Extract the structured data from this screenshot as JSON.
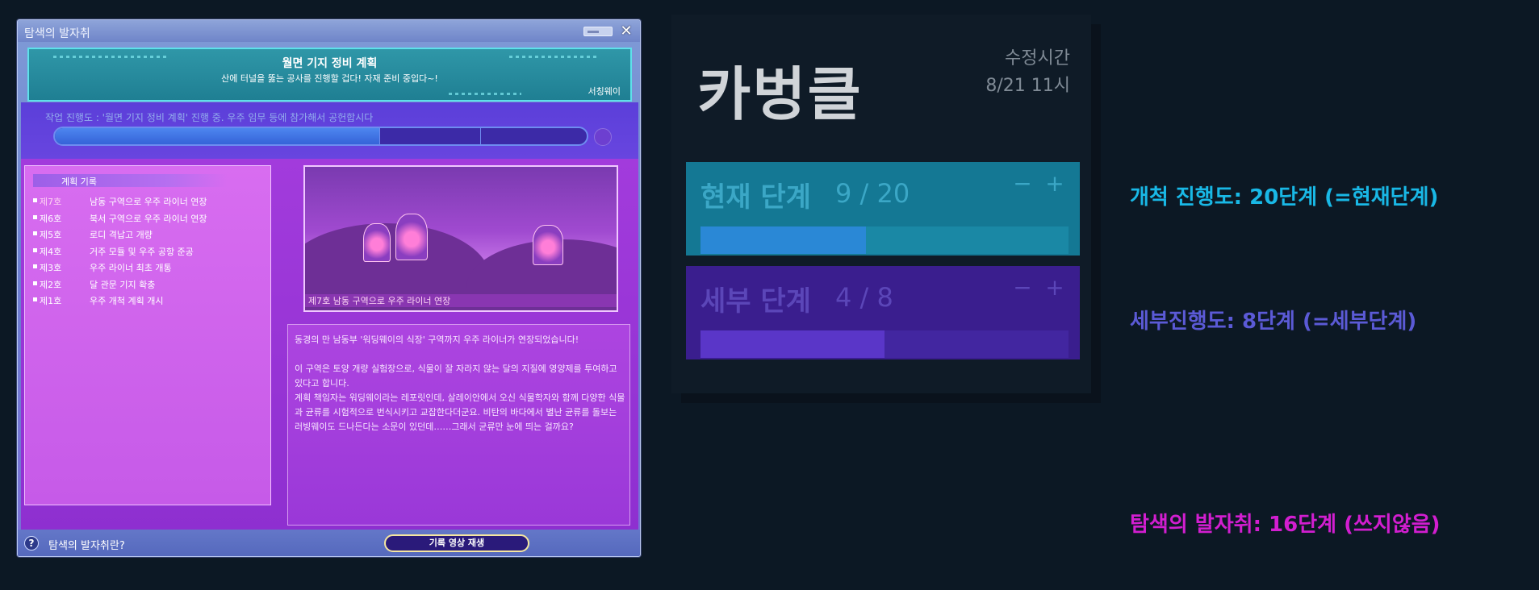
{
  "game_window": {
    "title": "탐색의 발자취",
    "banner": {
      "title": "월면 기지 정비 계획",
      "subtitle": "산에 터널을 뚫는 공사를 진행할 겁다! 자재 준비 중입다~!",
      "signature": "서칭웨이"
    },
    "progress": {
      "label": "작업 진행도 : '월면 기지 정비 계획' 진행 중. 우주 임무 등에 참가해서 공헌합시다",
      "fill_ratio": 0.61
    },
    "record_panel": {
      "header": "계획 기록",
      "records": [
        {
          "no": "제7호",
          "title": "남동 구역으로 우주 라이너 연장"
        },
        {
          "no": "제6호",
          "title": "북서 구역으로 우주 라이너 연장"
        },
        {
          "no": "제5호",
          "title": "로디 격납고 개량"
        },
        {
          "no": "제4호",
          "title": "거주 모듈 및 우주 공항 준공"
        },
        {
          "no": "제3호",
          "title": "우주 라이너 최초 개통"
        },
        {
          "no": "제2호",
          "title": "달 관문 기지 확충"
        },
        {
          "no": "제1호",
          "title": "우주 개척 계획 개시"
        }
      ]
    },
    "image_caption": "제7호 남동 구역으로 우주 라이너 연장",
    "body_text": "동경의 만 남동부 '워딩웨이의 식장' 구역까지 우주 라이너가 연장되었습니다!\n\n이 구역은 토양 개량 실험장으로, 식물이 잘 자라지 않는 달의 지질에 영양제를 투여하고 있다고 합니다.\n계획 책임자는 워딩웨이라는 레포릿인데, 살레이안에서 오신 식물학자와 함께 다양한 식물과 균류를 시험적으로 번식시키고 교잡한다더군요. 비탄의 바다에서 별난 균류를 돌보는 러빙웨이도 드나든다는 소문이 있던데……그래서 균류만 눈에 띄는 걸까요?",
    "footer": {
      "help_icon": "?",
      "help_label": "탐색의 발자취란?",
      "replay_button": "기록 영상 재생"
    }
  },
  "card": {
    "title": "카벙클",
    "modified_label": "수정시간",
    "modified_time": "8/21 11시",
    "current": {
      "label": "현재 단계",
      "count": "9 / 20",
      "value": 9,
      "max": 20,
      "minus": "−",
      "plus": "+"
    },
    "detail": {
      "label": "세부 단계",
      "count": "4 / 8",
      "value": 4,
      "max": 8,
      "minus": "−",
      "plus": "+"
    }
  },
  "notes": {
    "cyan": "개척 진행도: 20단계 (=현재단계)",
    "blue": "세부진행도: 8단계 (=세부단계)",
    "magenta": "탐색의 발자취: 16단계 (쓰지않음)"
  }
}
